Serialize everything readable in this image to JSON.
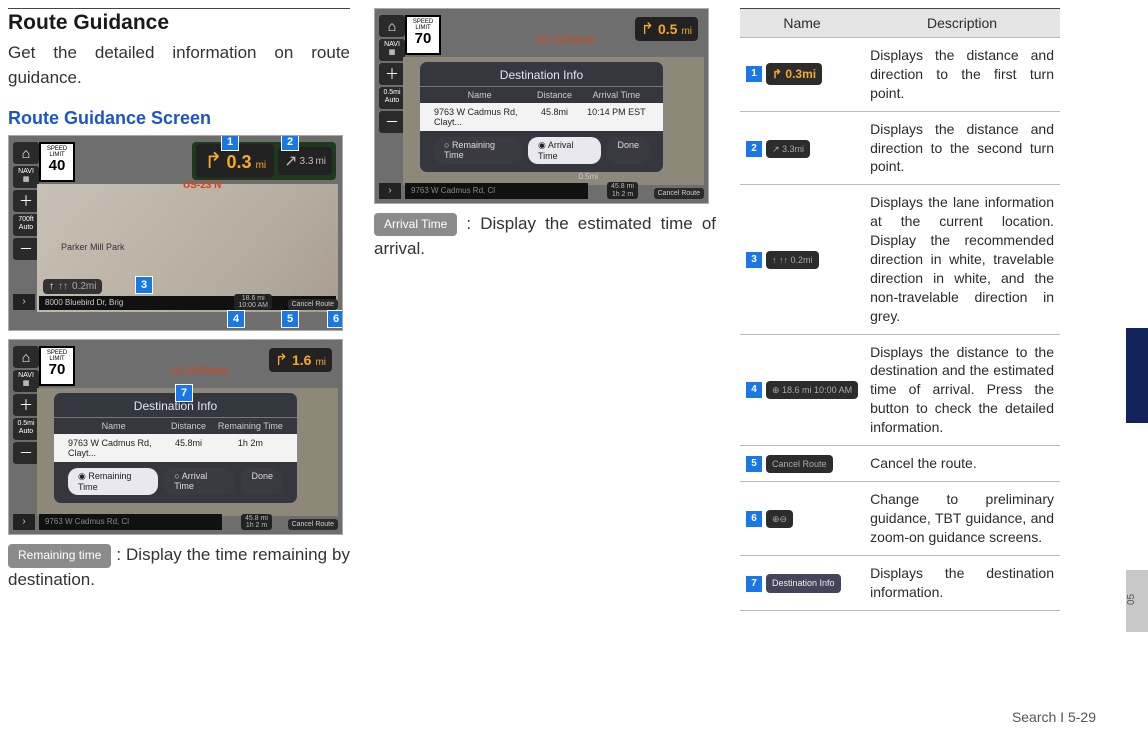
{
  "col1": {
    "section_title": "Route Guidance",
    "intro": "Get the detailed information on route guidance.",
    "subheading": "Route Guidance Screen",
    "screenshot1": {
      "speed_limit_label": "SPEED LIMIT",
      "speed_limit_value": "40",
      "first_turn_dist": "0.3",
      "first_turn_unit": "mi",
      "second_turn_dist": "3.3",
      "second_turn_unit": "mi",
      "road": "US-23 N",
      "lane_dist": "0.2mi",
      "bottom_addr": "8000 Bluebird Dr, Brig",
      "readout_dist": "18.6 mi",
      "readout_time": "10:00 AM",
      "cancel": "Cancel Route",
      "map_label": "Parker Mill Park"
    },
    "screenshot2": {
      "speed_limit_label": "SPEED LIMIT",
      "speed_limit_value": "70",
      "road": "US-23/Toledo",
      "first_turn_dist": "1.6",
      "first_turn_unit": "mi",
      "panel_title": "Destination Info",
      "col_a": "Name",
      "col_b": "Distance",
      "col_c": "Remaining Time",
      "row_addr": "9763 W Cadmus Rd, Clayt...",
      "row_dist": "45.8mi",
      "row_time": "1h 2m",
      "btn_remaining": "Remaining Time",
      "btn_arrival": "Arrival Time",
      "btn_done": "Done",
      "bottom_addr": "9763 W Cadmus Rd, Cl",
      "readout_dist": "45.8 mi",
      "readout_time": "1h  2 m",
      "cancel": "Cancel Route"
    },
    "pill_remaining": "Remaining time",
    "remaining_desc": " : Display the time remaining by destination."
  },
  "col2": {
    "screenshot3": {
      "speed_limit_label": "SPEED LIMIT",
      "speed_limit_value": "70",
      "road": "US-23/Toledo",
      "first_turn_dist": "0.5",
      "first_turn_unit": "mi",
      "panel_title": "Destination Info",
      "col_a": "Name",
      "col_b": "Distance",
      "col_c": "Arrival Time",
      "row_addr": "9763 W Cadmus Rd, Clayt...",
      "row_dist": "45.8mi",
      "row_time": "10:14 PM EST",
      "btn_remaining": "Remaining Time",
      "btn_arrival": "Arrival Time",
      "btn_done": "Done",
      "bottom_addr": "9763 W Cadmus Rd, Cl",
      "readout_dist": "45.8 mi",
      "readout_time": "1h  2 m",
      "cancel": "Cancel Route",
      "scale": "0.5mi"
    },
    "pill_arrival": "Arrival Time",
    "arrival_desc": " : Display the estimated time of arrival."
  },
  "table": {
    "head_name": "Name",
    "head_desc": "Description",
    "rows": [
      {
        "num": "1",
        "icon_text": "↱ 0.3mi",
        "icon_class": "or",
        "desc": "Displays the distance and direction to the first turn point."
      },
      {
        "num": "2",
        "icon_text": "↗  3.3mi",
        "icon_class": "",
        "desc": "Displays the distance and direction to the second turn point."
      },
      {
        "num": "3",
        "icon_text": "↑  ↑↑  0.2mi",
        "icon_class": "",
        "desc": "Displays the lane information at the current location. Display the recommended direction in white,  travelable direction in white, and the non-travelable direction in grey."
      },
      {
        "num": "4",
        "icon_text": "⊕ 18.6 mi 10:00 AM",
        "icon_class": "",
        "desc": "Displays the distance to the destination and the estimated time of arrival. Press the button to check the detailed information."
      },
      {
        "num": "5",
        "icon_text": "Cancel Route",
        "icon_class": "",
        "desc": "Cancel the route."
      },
      {
        "num": "6",
        "icon_text": "⊕⊖",
        "icon_class": "",
        "desc": "Change to preliminary guidance, TBT guidance, and zoom-on guidance screens."
      },
      {
        "num": "7",
        "icon_text": "Destination Info",
        "icon_class": "di",
        "desc": "Displays the destination information."
      }
    ]
  },
  "sidebar_grey": "05",
  "footer": "Search I 5-29"
}
